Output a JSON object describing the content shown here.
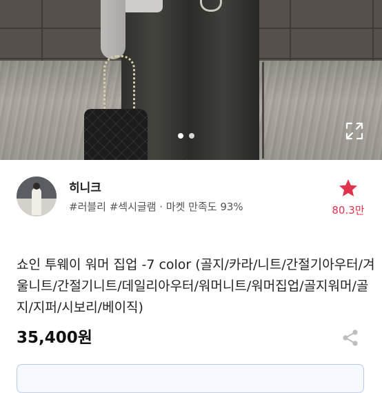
{
  "gallery": {
    "page_count": 2,
    "current_page": 1,
    "expand_icon": "expand-icon"
  },
  "seller": {
    "name": "히니크",
    "tags": "#러블리 #섹시글램 · 마켓 만족도 93%",
    "favorite_icon": "star-icon",
    "favorite_count": "80.3만",
    "accent_color": "#e0334d"
  },
  "product": {
    "title": "쇼인 투웨이 워머 집업 -7 color (골지/카라/니트/간절기아우터/겨울니트/간절기니트/데일리아우터/워머니트/워머집업/골지워머/골지/지퍼/시보리/베이직)",
    "price": "35,400원",
    "share_icon": "share-icon"
  },
  "notice": {
    "text": "",
    "border_color": "#b9c6ef"
  }
}
